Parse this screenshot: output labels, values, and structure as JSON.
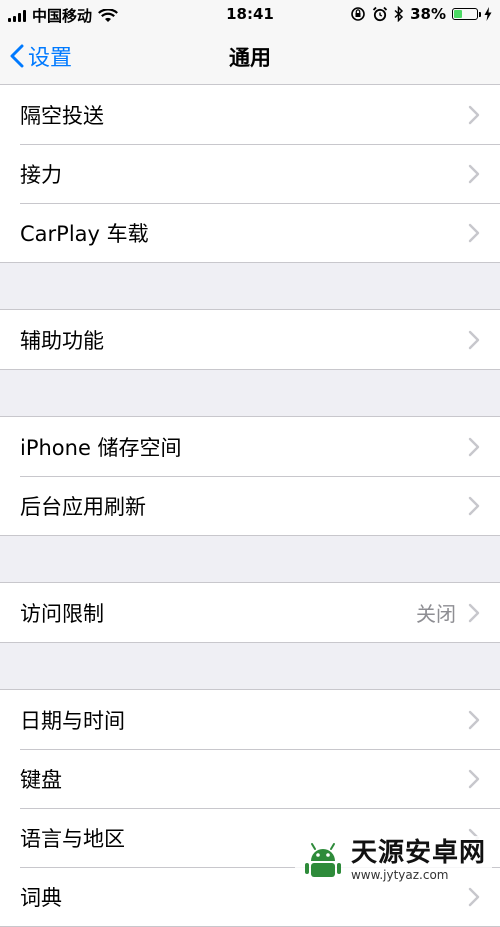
{
  "status_bar": {
    "carrier": "中国移动",
    "time": "18:41",
    "battery_percent_text": "38%",
    "battery_level": 0.38
  },
  "nav": {
    "back_label": "设置",
    "title": "通用"
  },
  "groups": [
    {
      "rows": [
        {
          "label": "隔空投送"
        },
        {
          "label": "接力"
        },
        {
          "label": "CarPlay 车载"
        }
      ]
    },
    {
      "rows": [
        {
          "label": "辅助功能"
        }
      ]
    },
    {
      "rows": [
        {
          "label": "iPhone 储存空间"
        },
        {
          "label": "后台应用刷新"
        }
      ]
    },
    {
      "rows": [
        {
          "label": "访问限制",
          "value": "关闭"
        }
      ]
    },
    {
      "rows": [
        {
          "label": "日期与时间"
        },
        {
          "label": "键盘"
        },
        {
          "label": "语言与地区"
        },
        {
          "label": "词典"
        }
      ]
    }
  ],
  "watermark": {
    "title": "天源安卓网",
    "url": "www.jytyaz.com"
  },
  "colors": {
    "accent": "#007aff",
    "battery": "#4cd964",
    "background": "#efeff4",
    "separator": "#c8c7cc"
  }
}
